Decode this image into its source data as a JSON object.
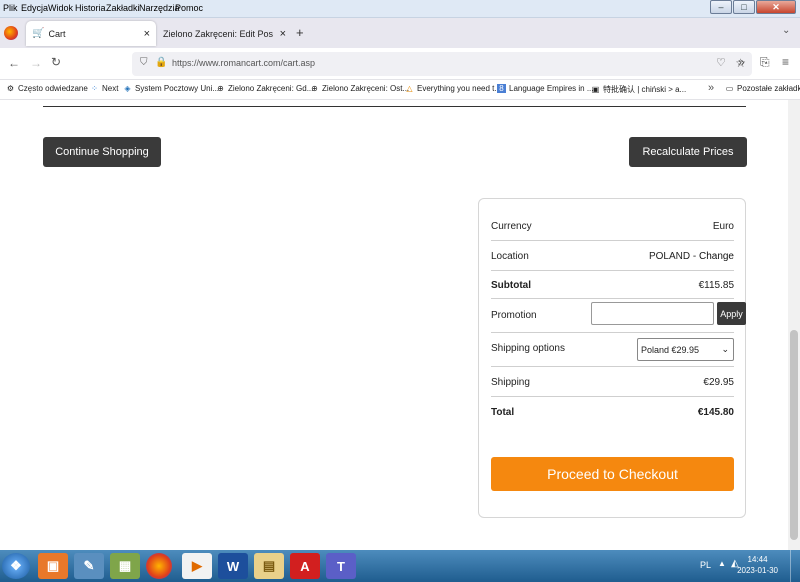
{
  "menubar": {
    "items": [
      "Plik",
      "Edycja",
      "Widok",
      "Historia",
      "Zakładki",
      "Narzędzia",
      "Pomoc"
    ]
  },
  "tabs": [
    {
      "label": "Cart",
      "close": "×"
    },
    {
      "label": "Zielono Zakręceni: Edit Post: Gdzie i",
      "close": "×"
    }
  ],
  "new_tab": "+",
  "url": "https://www.romancart.com/cart.asp",
  "bookmarks": [
    {
      "label": "Często odwiedzane",
      "icon": "gear-icon"
    },
    {
      "label": "Next",
      "icon": "grid-icon"
    },
    {
      "label": "System Pocztowy Uni...",
      "icon": "mail-icon"
    },
    {
      "label": "Zielono Zakręceni: Gd...",
      "icon": "globe-icon"
    },
    {
      "label": "Zielono Zakręceni: Ost...",
      "icon": "globe-icon"
    },
    {
      "label": "Everything you need t...",
      "icon": "triangle-icon"
    },
    {
      "label": "Language Empires in ...",
      "icon": "g-icon"
    },
    {
      "label": "特批确认 | chiński > a...",
      "icon": "doc-icon"
    },
    {
      "label": "Pozostałe zakładki",
      "icon": "folder-icon"
    }
  ],
  "page": {
    "continue_shopping": "Continue Shopping",
    "recalculate_prices": "Recalculate Prices"
  },
  "summary": {
    "currency_label": "Currency",
    "currency_value": "Euro",
    "location_label": "Location",
    "location_value": "POLAND - ",
    "location_change": "Change",
    "subtotal_label": "Subtotal",
    "subtotal_value": "€115.85",
    "promotion_label": "Promotion",
    "promotion_value": "",
    "apply_label": "Apply",
    "shipping_options_label": "Shipping options",
    "shipping_option_selected": "Poland €29.95",
    "shipping_label": "Shipping",
    "shipping_value": "€29.95",
    "total_label": "Total",
    "total_value": "€145.80",
    "checkout_label": "Proceed to Checkout"
  },
  "taskbar": {
    "lang": "PL",
    "time": "14:44",
    "date": "2023-01-30"
  },
  "colors": {
    "accent_orange": "#f5880f",
    "dark_button": "#3a3a3a"
  }
}
